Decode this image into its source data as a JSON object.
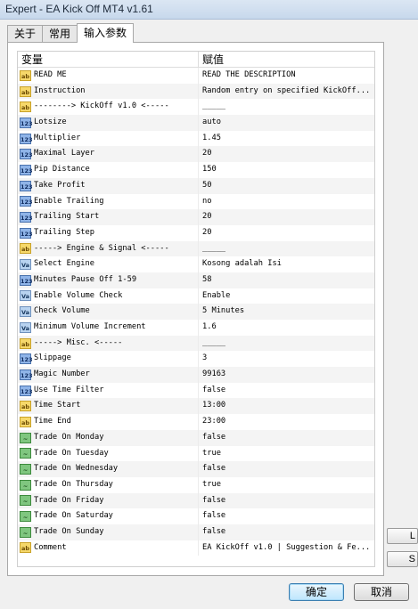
{
  "window": {
    "title": "Expert - EA Kick Off MT4 v1.61"
  },
  "tabs": [
    "关于",
    "常用",
    "输入参数"
  ],
  "table": {
    "headers": [
      "变量",
      "赋值"
    ],
    "rows": [
      {
        "type": "ab",
        "name": "READ ME",
        "value": "READ THE DESCRIPTION"
      },
      {
        "type": "ab",
        "name": "Instruction",
        "value": "Random entry on specified KickOff..."
      },
      {
        "type": "ab",
        "name": "--------> KickOff v1.0 <-----",
        "value": "_____"
      },
      {
        "type": "num",
        "name": "Lotsize",
        "value": "auto"
      },
      {
        "type": "num",
        "name": "Multiplier",
        "value": "1.45"
      },
      {
        "type": "num",
        "name": "Maximal Layer",
        "value": "20"
      },
      {
        "type": "num",
        "name": "Pip Distance",
        "value": "150"
      },
      {
        "type": "num",
        "name": "Take Profit",
        "value": "50"
      },
      {
        "type": "num",
        "name": "Enable Trailing",
        "value": "no"
      },
      {
        "type": "num",
        "name": "Trailing Start",
        "value": "20"
      },
      {
        "type": "num",
        "name": "Trailing Step",
        "value": "20"
      },
      {
        "type": "ab",
        "name": "-----> Engine & Signal <-----",
        "value": "_____"
      },
      {
        "type": "enum",
        "name": "Select Engine",
        "value": "Kosong adalah Isi"
      },
      {
        "type": "num",
        "name": "Minutes Pause Off 1-59",
        "value": "58"
      },
      {
        "type": "enum",
        "name": "Enable Volume Check",
        "value": "Enable"
      },
      {
        "type": "enum",
        "name": "Check Volume",
        "value": "5 Minutes"
      },
      {
        "type": "enum",
        "name": "Minimum Volume Increment",
        "value": "1.6"
      },
      {
        "type": "ab",
        "name": "-----> Misc. <-----",
        "value": "_____"
      },
      {
        "type": "num",
        "name": "Slippage",
        "value": "3"
      },
      {
        "type": "num",
        "name": "Magic Number",
        "value": "99163"
      },
      {
        "type": "num",
        "name": "Use Time Filter",
        "value": "false"
      },
      {
        "type": "ab",
        "name": "Time Start",
        "value": "13:00"
      },
      {
        "type": "ab",
        "name": "Time End",
        "value": "23:00"
      },
      {
        "type": "bool",
        "name": "Trade On Monday",
        "value": "false"
      },
      {
        "type": "bool",
        "name": "Trade On Tuesday",
        "value": "true"
      },
      {
        "type": "bool",
        "name": "Trade On Wednesday",
        "value": "false"
      },
      {
        "type": "bool",
        "name": "Trade On Thursday",
        "value": "true"
      },
      {
        "type": "bool",
        "name": "Trade On Friday",
        "value": "false"
      },
      {
        "type": "bool",
        "name": "Trade On Saturday",
        "value": "false"
      },
      {
        "type": "bool",
        "name": "Trade On Sunday",
        "value": "false"
      },
      {
        "type": "ab",
        "name": "Comment",
        "value": "EA KickOff v1.0 | Suggestion & Fe..."
      }
    ]
  },
  "side_buttons": [
    "L",
    "S"
  ],
  "buttons": {
    "ok": "确定",
    "cancel": "取消"
  },
  "icon_labels": {
    "ab": "ab",
    "num": "123",
    "bool": "~",
    "enum": "Va"
  }
}
